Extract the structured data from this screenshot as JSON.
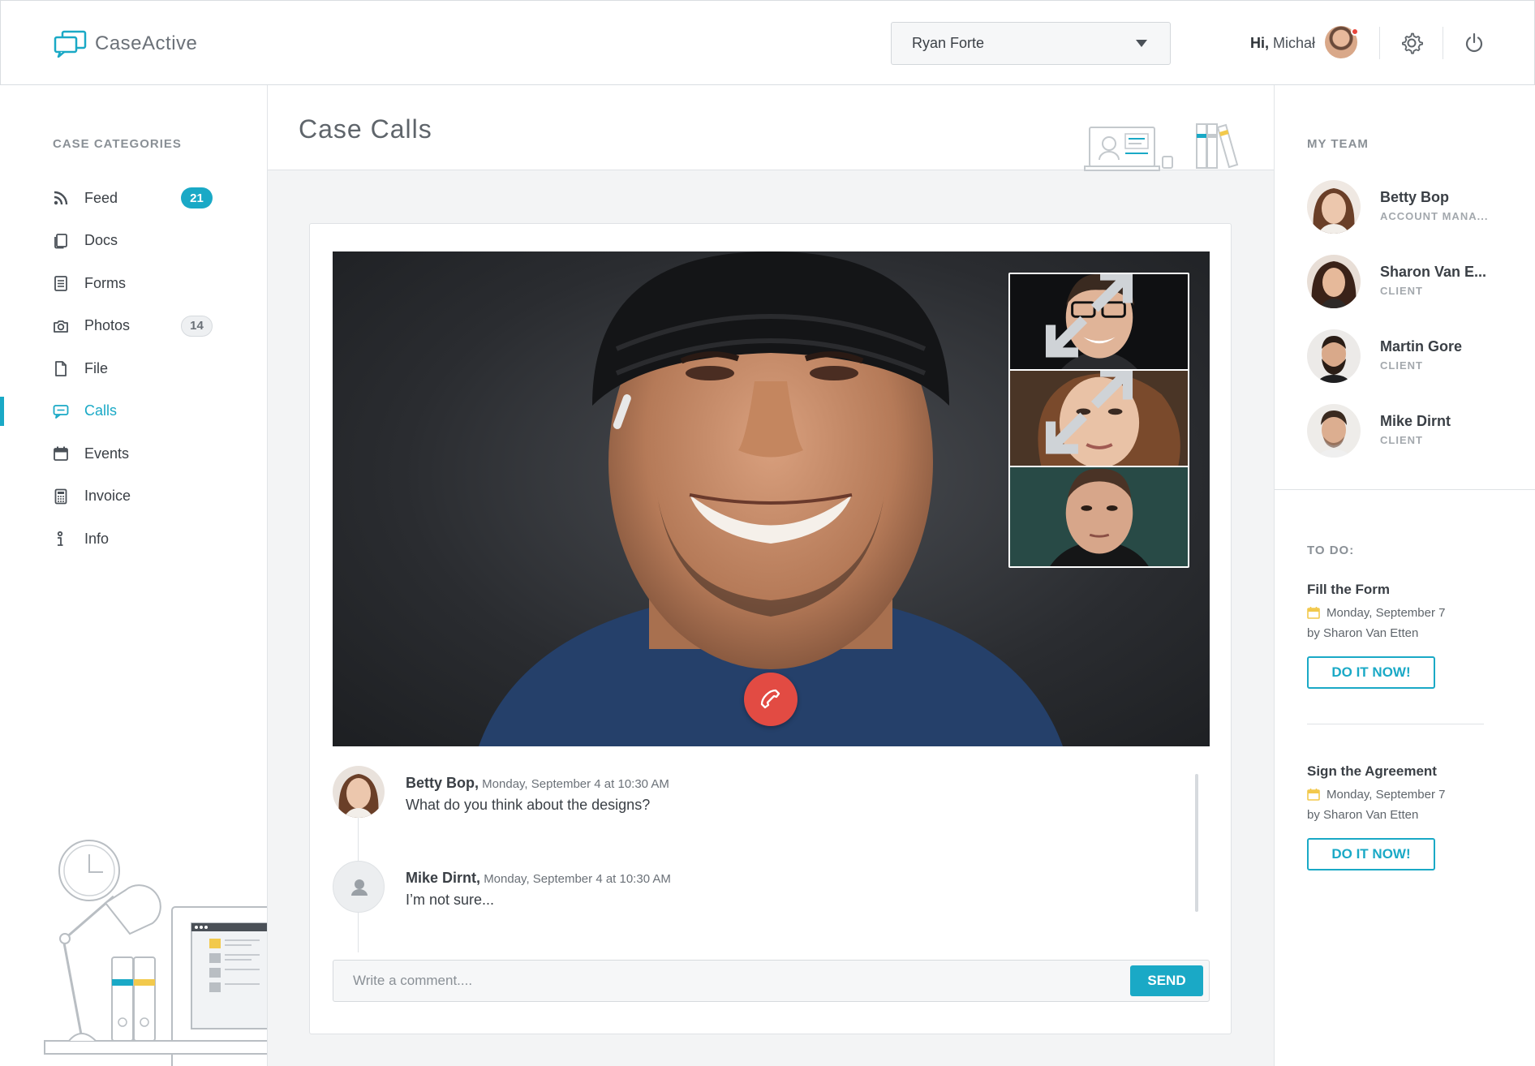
{
  "header": {
    "logo_text": "CaseActive",
    "case_select_value": "Ryan Forte",
    "greeting_prefix": "Hi,",
    "greeting_name": "Michał"
  },
  "sidebar": {
    "title": "CASE CATEGORIES",
    "items": [
      {
        "label": "Feed",
        "icon": "rss-icon",
        "badge": "21"
      },
      {
        "label": "Docs",
        "icon": "docs-icon"
      },
      {
        "label": "Forms",
        "icon": "forms-icon"
      },
      {
        "label": "Photos",
        "icon": "camera-icon",
        "badge": "14"
      },
      {
        "label": "File",
        "icon": "file-icon"
      },
      {
        "label": "Calls",
        "icon": "chat-icon",
        "active": true
      },
      {
        "label": "Events",
        "icon": "calendar-icon"
      },
      {
        "label": "Invoice",
        "icon": "calculator-icon"
      },
      {
        "label": "Info",
        "icon": "info-icon"
      }
    ]
  },
  "main": {
    "title": "Case Calls",
    "comments": [
      {
        "author": "Betty Bop,",
        "timestamp": "Monday, September 4 at 10:30 AM",
        "text": "What do you think about the designs?"
      },
      {
        "author": "Mike Dirnt,",
        "timestamp": "Monday, September 4 at 10:30 AM",
        "text": "I’m not sure..."
      }
    ],
    "comment_placeholder": "Write a comment....",
    "send_label": "SEND"
  },
  "team": {
    "title": "MY TEAM",
    "members": [
      {
        "name": "Betty Bop",
        "role": "ACCOUNT MANA..."
      },
      {
        "name": "Sharon Van E...",
        "role": "CLIENT"
      },
      {
        "name": "Martin Gore",
        "role": "CLIENT"
      },
      {
        "name": "Mike Dirnt",
        "role": "CLIENT"
      }
    ]
  },
  "todo": {
    "title": "TO DO:",
    "tasks": [
      {
        "title": "Fill the Form",
        "date": "Monday, September 7",
        "by": "by Sharon Van Etten",
        "button": "DO IT NOW!"
      },
      {
        "title": "Sign the Agreement",
        "date": "Monday, September 7",
        "by": "by Sharon Van Etten",
        "button": "DO IT NOW!"
      }
    ]
  },
  "colors": {
    "accent": "#1aa9c6",
    "end_call": "#e24b43",
    "todo_calendar": "#f2c94c",
    "notification_dot": "#e8453c"
  }
}
